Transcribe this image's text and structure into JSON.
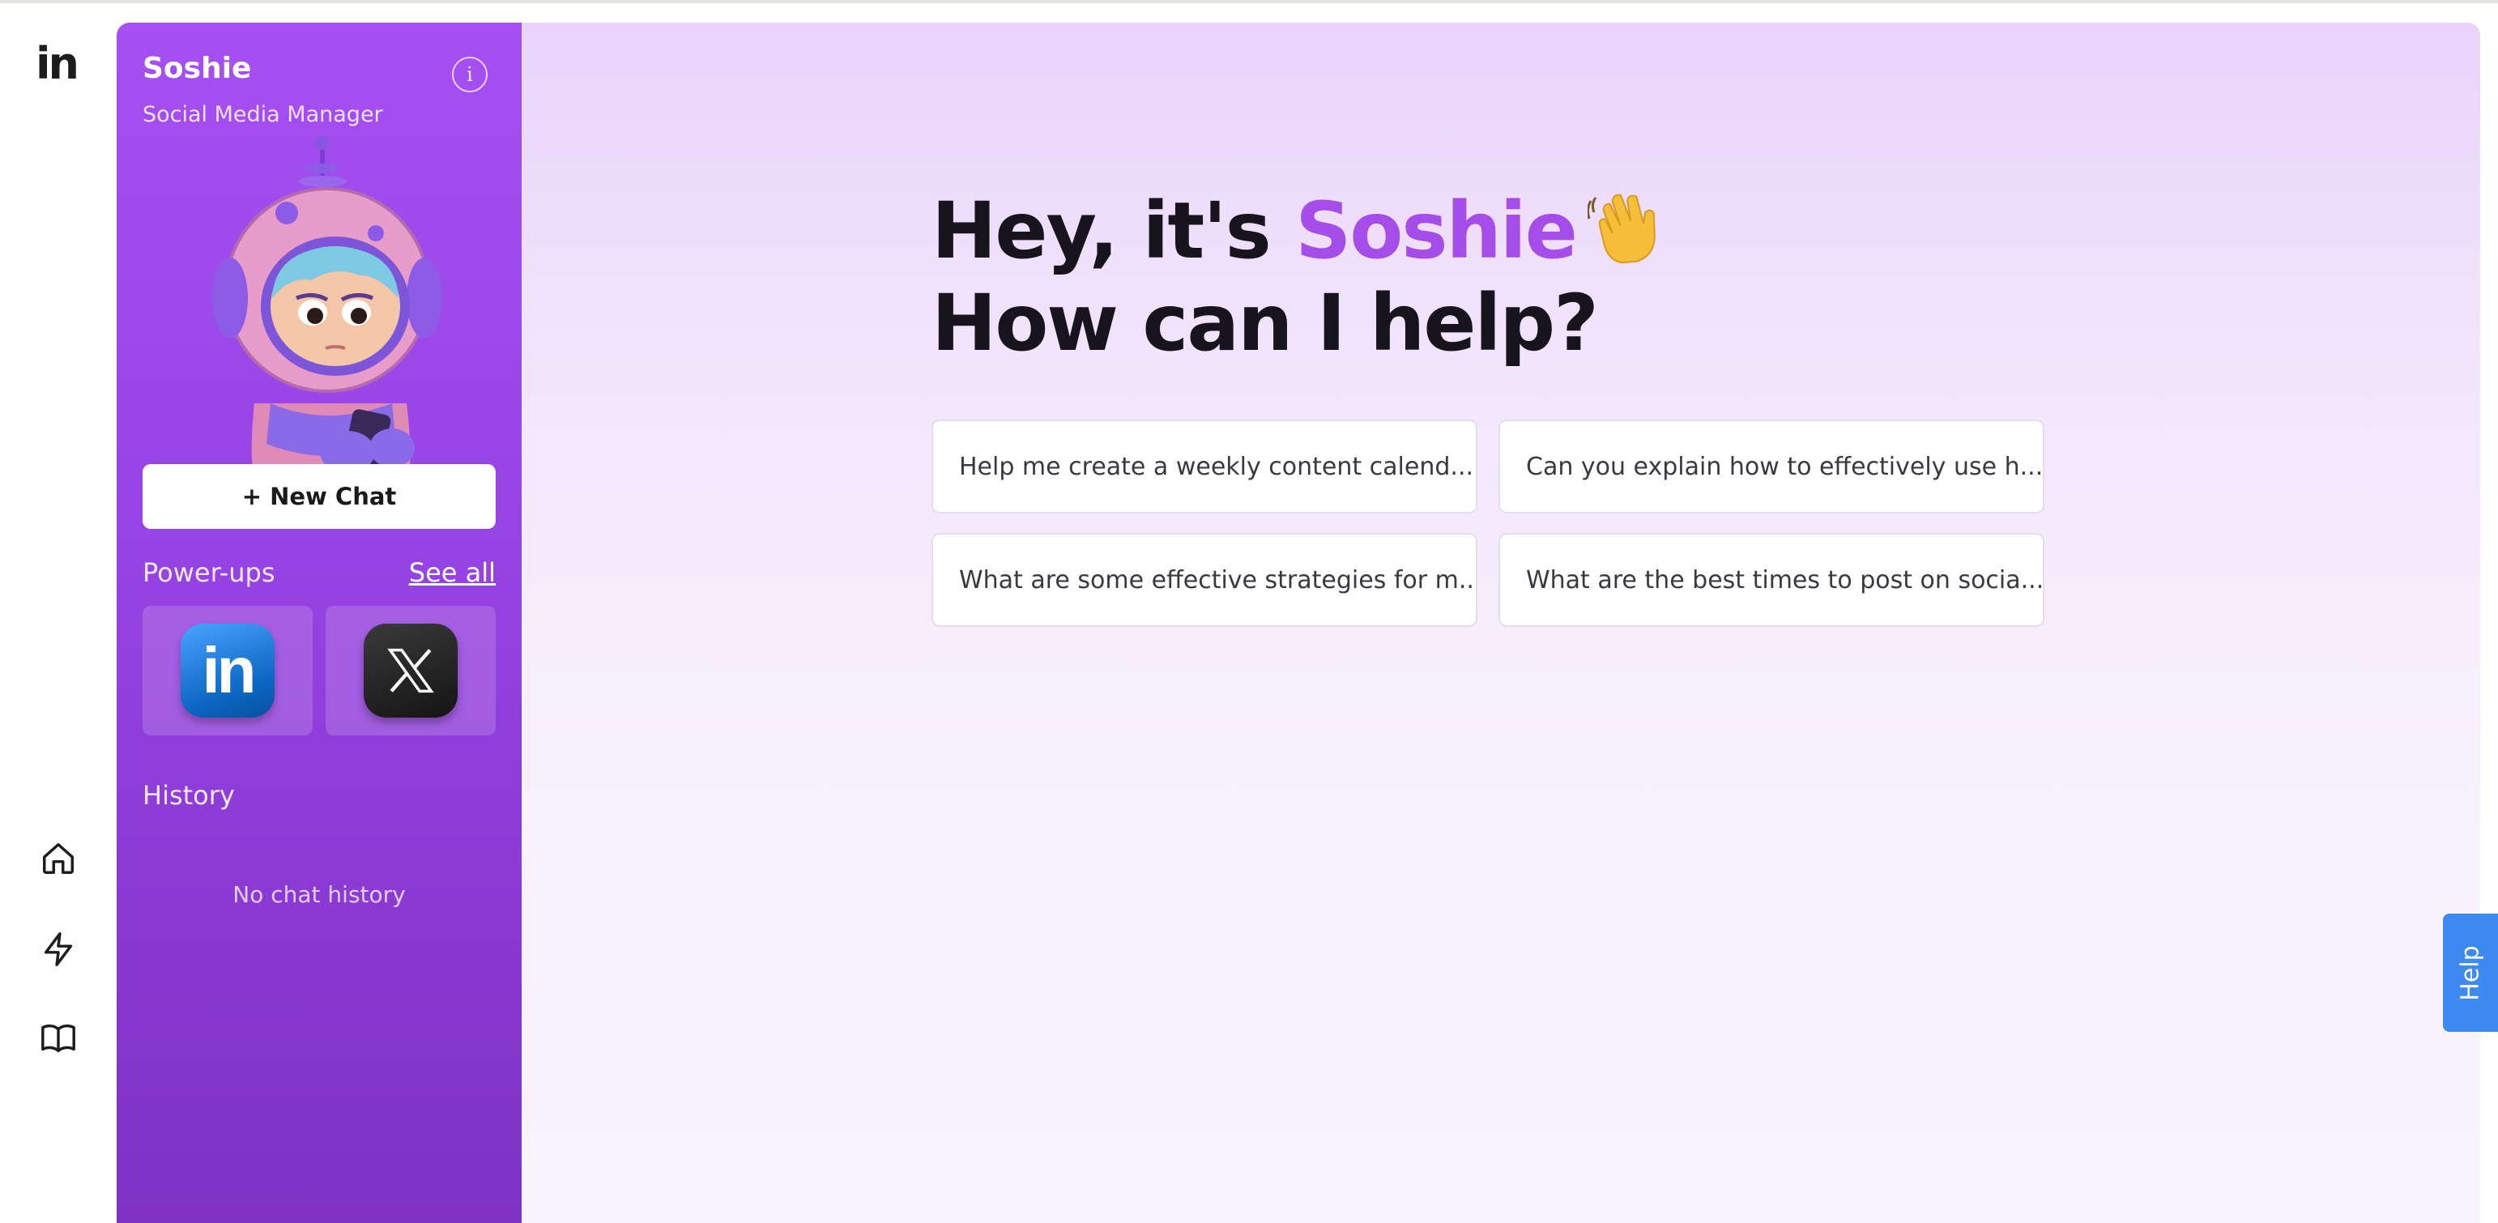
{
  "rail": {
    "logo": "in",
    "nav": [
      "home-icon",
      "lightning-icon",
      "book-icon"
    ]
  },
  "agent": {
    "name": "Soshie",
    "role": "Social Media Manager",
    "new_chat_label": "+ New Chat",
    "powerups_label": "Power-ups",
    "see_all_label": "See all",
    "powerups": [
      {
        "icon": "linkedin-icon",
        "glyph": "in"
      },
      {
        "icon": "x-icon"
      }
    ],
    "history_label": "History",
    "no_history_text": "No chat history"
  },
  "main": {
    "greeting_prefix": "Hey, it's ",
    "greeting_name": "Soshie",
    "greeting_line2": "How can I help?",
    "suggestions": [
      "Help me create a weekly content calend...",
      "Can you explain how to effectively use h...",
      "What are some effective strategies for m...",
      "What are the best times to post on socia..."
    ]
  },
  "help_tab_label": "Help",
  "colors": {
    "sidebar_purple": "#9643e3",
    "accent": "#a44de9",
    "help_blue": "#3d8bf2"
  }
}
